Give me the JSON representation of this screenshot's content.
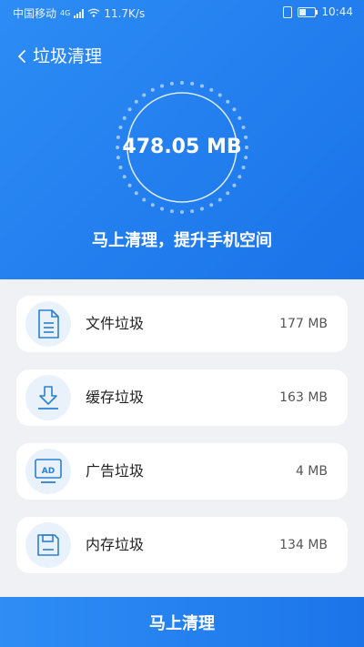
{
  "status_bar": {
    "carrier": "中国移动",
    "network": "4G",
    "speed": "11.7K/s",
    "time": "10:44",
    "icons": [
      "signal-icon",
      "wifi-icon",
      "vibrate-icon",
      "battery-icon"
    ]
  },
  "header": {
    "back_icon": "chevron-left-icon",
    "title": "垃圾清理"
  },
  "summary": {
    "total_size": "478.05 MB",
    "slogan": "马上清理，提升手机空间"
  },
  "items": [
    {
      "label": "文件垃圾",
      "size": "177 MB",
      "icon": "file-icon"
    },
    {
      "label": "缓存垃圾",
      "size": "163 MB",
      "icon": "download-icon"
    },
    {
      "label": "广告垃圾",
      "size": "4 MB",
      "icon": "ad-icon"
    },
    {
      "label": "内存垃圾",
      "size": "134 MB",
      "icon": "floppy-disk-icon"
    }
  ],
  "action": {
    "clean_label": "马上清理"
  },
  "colors": {
    "primary": "#1a73e8",
    "icon_blue": "#2c7fd0",
    "icon_bg": "#e9f2fb",
    "background": "#f0f1f5"
  }
}
